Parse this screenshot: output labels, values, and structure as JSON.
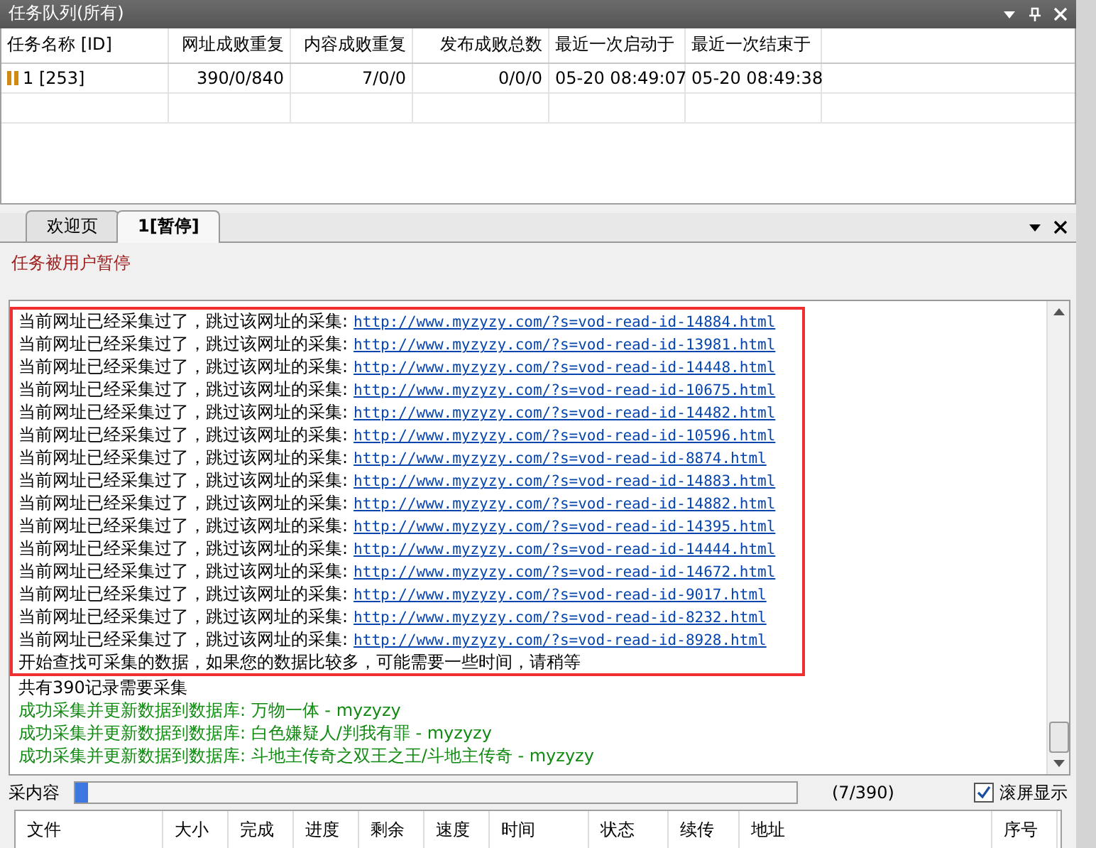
{
  "queue_panel": {
    "title": "任务队列(所有)",
    "columns": [
      "任务名称 [ID]",
      "网址成败重复",
      "内容成败重复",
      "发布成败总数",
      "最近一次启动于",
      "最近一次结束于"
    ],
    "rows": [
      {
        "cells": [
          "1 [253]",
          "390/0/840",
          "7/0/0",
          "0/0/0",
          "05-20 08:49:07",
          "05-20 08:49:38"
        ],
        "paused": true
      }
    ]
  },
  "tabs": [
    {
      "label": "欢迎页",
      "selected": false
    },
    {
      "label": "1[暂停]",
      "selected": true
    }
  ],
  "status_message": "任务被用户暂停",
  "log": [
    {
      "kind": "skip",
      "text": "当前网址已经采集过了，跳过该网址的采集:",
      "url": "http://www.myzyzy.com/?s=vod-read-id-14884.html"
    },
    {
      "kind": "skip",
      "text": "当前网址已经采集过了，跳过该网址的采集:",
      "url": "http://www.myzyzy.com/?s=vod-read-id-13981.html"
    },
    {
      "kind": "skip",
      "text": "当前网址已经采集过了，跳过该网址的采集:",
      "url": "http://www.myzyzy.com/?s=vod-read-id-14448.html"
    },
    {
      "kind": "skip",
      "text": "当前网址已经采集过了，跳过该网址的采集:",
      "url": "http://www.myzyzy.com/?s=vod-read-id-10675.html"
    },
    {
      "kind": "skip",
      "text": "当前网址已经采集过了，跳过该网址的采集:",
      "url": "http://www.myzyzy.com/?s=vod-read-id-14482.html"
    },
    {
      "kind": "skip",
      "text": "当前网址已经采集过了，跳过该网址的采集:",
      "url": "http://www.myzyzy.com/?s=vod-read-id-10596.html"
    },
    {
      "kind": "skip",
      "text": "当前网址已经采集过了，跳过该网址的采集:",
      "url": "http://www.myzyzy.com/?s=vod-read-id-8874.html"
    },
    {
      "kind": "skip",
      "text": "当前网址已经采集过了，跳过该网址的采集:",
      "url": "http://www.myzyzy.com/?s=vod-read-id-14883.html"
    },
    {
      "kind": "skip",
      "text": "当前网址已经采集过了，跳过该网址的采集:",
      "url": "http://www.myzyzy.com/?s=vod-read-id-14882.html"
    },
    {
      "kind": "skip",
      "text": "当前网址已经采集过了，跳过该网址的采集:",
      "url": "http://www.myzyzy.com/?s=vod-read-id-14395.html"
    },
    {
      "kind": "skip",
      "text": "当前网址已经采集过了，跳过该网址的采集:",
      "url": "http://www.myzyzy.com/?s=vod-read-id-14444.html"
    },
    {
      "kind": "skip",
      "text": "当前网址已经采集过了，跳过该网址的采集:",
      "url": "http://www.myzyzy.com/?s=vod-read-id-14672.html"
    },
    {
      "kind": "skip",
      "text": "当前网址已经采集过了，跳过该网址的采集:",
      "url": "http://www.myzyzy.com/?s=vod-read-id-9017.html"
    },
    {
      "kind": "skip",
      "text": "当前网址已经采集过了，跳过该网址的采集:",
      "url": "http://www.myzyzy.com/?s=vod-read-id-8232.html"
    },
    {
      "kind": "skip",
      "text": "当前网址已经采集过了，跳过该网址的采集:",
      "url": "http://www.myzyzy.com/?s=vod-read-id-8928.html"
    },
    {
      "kind": "info",
      "text": "开始查找可采集的数据，如果您的数据比较多，可能需要一些时间，请稍等"
    },
    {
      "kind": "info",
      "text": "共有390记录需要采集"
    },
    {
      "kind": "success",
      "text": "成功采集并更新数据到数据库: 万物一体 - myzyzy"
    },
    {
      "kind": "success",
      "text": "成功采集并更新数据到数据库: 白色嫌疑人/判我有罪 - myzyzy"
    },
    {
      "kind": "success",
      "text": "成功采集并更新数据到数据库: 斗地主传奇之双王之王/斗地主传奇 - myzyzy"
    }
  ],
  "highlight_frame": {
    "shown": true
  },
  "progress": {
    "label": "采内容",
    "level": 0.018,
    "reading": "(7/390)"
  },
  "scroll_display": {
    "label": "滚屏显示",
    "checked": true
  },
  "file_list": {
    "columns": [
      "文件",
      "大小",
      "完成",
      "进度",
      "剩余",
      "速度",
      "时间",
      "状态",
      "续传",
      "地址",
      "序号"
    ]
  }
}
